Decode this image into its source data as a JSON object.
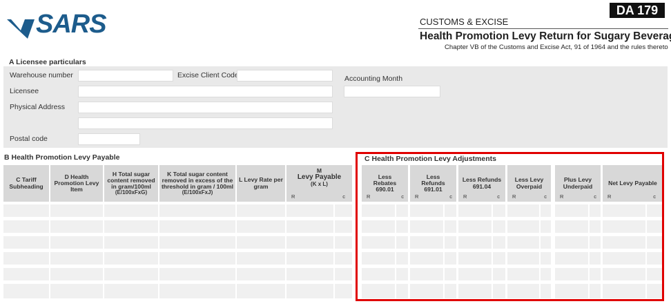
{
  "header": {
    "logo_text": "SARS",
    "form_number": "DA 179",
    "department": "CUSTOMS & EXCISE",
    "title": "Health Promotion Levy Return for Sugary Beverages",
    "subtitle": "Chapter VB of the Customs and Excise Act, 91 of 1964 and the rules thereto"
  },
  "section_a": {
    "title": "A Licensee particulars",
    "fields": {
      "warehouse_number": {
        "label": "Warehouse number",
        "value": ""
      },
      "excise_client_code": {
        "label": "Excise Client Code",
        "value": ""
      },
      "accounting_month": {
        "label": "Accounting Month",
        "value": ""
      },
      "licensee": {
        "label": "Licensee",
        "value": ""
      },
      "physical_address": {
        "label": "Physical Address",
        "value": ""
      },
      "physical_address_2": {
        "value": ""
      },
      "postal_code": {
        "label": "Postal code",
        "value": ""
      }
    }
  },
  "section_b": {
    "title": "B Health Promotion Levy Payable",
    "columns": {
      "c": "C Tariff Subheading",
      "d": "D Health Promotion Levy Item",
      "h": "H Total sugar content removed in gram/100ml",
      "h_formula": "(E/100xFxG)",
      "k": "K Total sugar  content removed in excess of the threshold in gram / 100ml",
      "k_formula": "(E/100xFxJ)",
      "l": "L Levy Rate per gram",
      "m_letter": "M",
      "m": "Levy Payable",
      "m_formula": "(K x L)"
    }
  },
  "section_c": {
    "title": "C Health Promotion Levy Adjustments",
    "columns": {
      "rebates": "Less Rebates 690.01",
      "refunds": "Less Refunds 691.01",
      "refunds_2": "Less Refunds 691.04",
      "overpaid": "Less Levy Overpaid",
      "underpaid": "Plus Levy Underpaid",
      "net": "Net Levy Payable"
    }
  },
  "currency": {
    "rand": "R",
    "cents": "c"
  },
  "colors": {
    "brand_blue": "#1d5c8c",
    "highlight_red": "#e00000",
    "panel_grey": "#e9e9e9",
    "header_grey": "#d8d8d8"
  }
}
